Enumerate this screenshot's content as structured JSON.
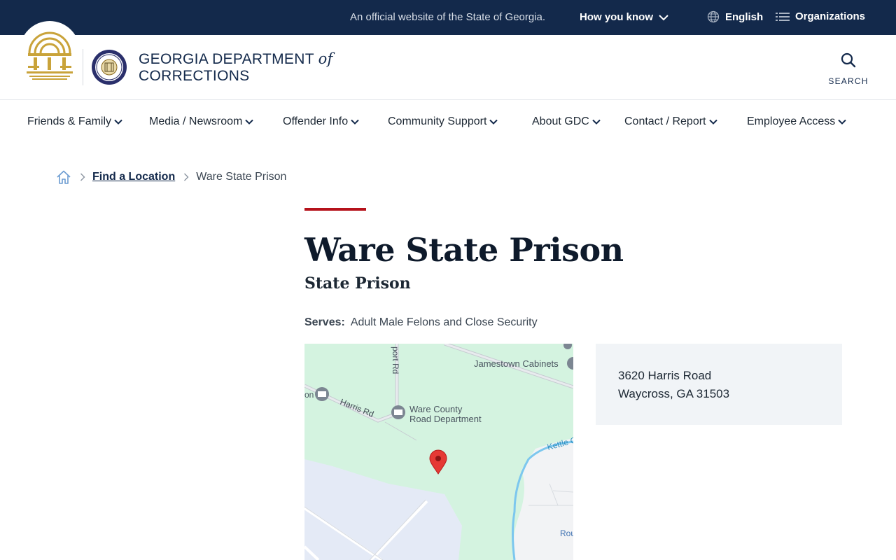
{
  "banner": {
    "official_text": "An official website of the State of Georgia.",
    "how_you_know": "How you know",
    "language": "English",
    "organizations": "Organizations"
  },
  "header": {
    "brand_line1": "GEORGIA DEPARTMENT",
    "brand_of": "of",
    "brand_line2": "CORRECTIONS",
    "search_label": "SEARCH"
  },
  "nav": {
    "items": [
      {
        "label": "Friends & Family"
      },
      {
        "label": "Media / Newsroom"
      },
      {
        "label": "Offender Info"
      },
      {
        "label": "Community Support"
      },
      {
        "label": "About GDC"
      },
      {
        "label": "Contact / Report"
      },
      {
        "label": "Employee Access"
      }
    ]
  },
  "breadcrumb": {
    "link": "Find a Location",
    "current": "Ware State Prison"
  },
  "page": {
    "title": "Ware State Prison",
    "subtitle": "State Prison",
    "serves_label": "Serves:",
    "serves_value": "Adult Male Felons and Close Security"
  },
  "map": {
    "labels": {
      "road_vertical": "port Rd",
      "harris_rd": "Harris Rd",
      "jamestown": "Jamestown Cabinets",
      "ware_county_1": "Ware County",
      "ware_county_2": "Road Department",
      "kettle": "Kettle C",
      "rou": "Rou",
      "on": "on"
    },
    "pin_color": "#e53935"
  },
  "address": {
    "line1": "3620 Harris Road",
    "line2": "Waycross, GA 31503"
  },
  "colors": {
    "navy": "#13294b",
    "accent_red": "#b5121b",
    "gold": "#c9a33a"
  }
}
